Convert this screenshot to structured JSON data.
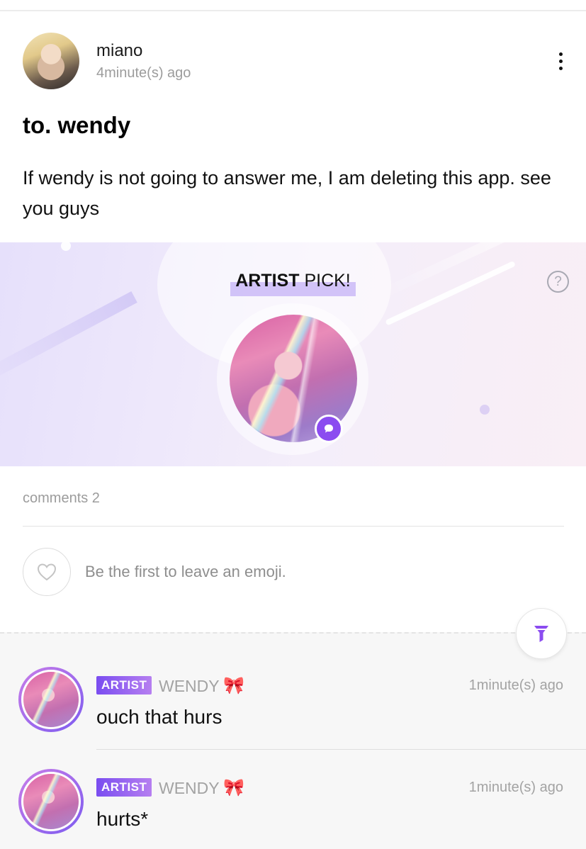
{
  "post": {
    "author": "miano",
    "time": "4minute(s) ago",
    "title": "to. wendy",
    "body": "If wendy is not going to answer me, I am deleting this app. see you guys",
    "more_icon": "more-vertical-icon"
  },
  "artist_pick": {
    "title_strong": "ARTIST",
    "title_rest": " PICK!",
    "help_label": "?",
    "badge_icon": "chat-bubble-icon",
    "accent_color": "#8b4cf0"
  },
  "comments_section": {
    "count_label": "comments 2",
    "emoji_prompt": "Be the first to leave an emoji.",
    "heart_icon": "heart-outline-icon",
    "filter_icon": "filter-funnel-icon"
  },
  "comments": [
    {
      "badge": "ARTIST",
      "name": "WENDY",
      "emoji": "🎀",
      "time": "1minute(s) ago",
      "text": "ouch that hurs"
    },
    {
      "badge": "ARTIST",
      "name": "WENDY",
      "emoji": "🎀",
      "time": "1minute(s) ago",
      "text": "hurts*"
    }
  ]
}
